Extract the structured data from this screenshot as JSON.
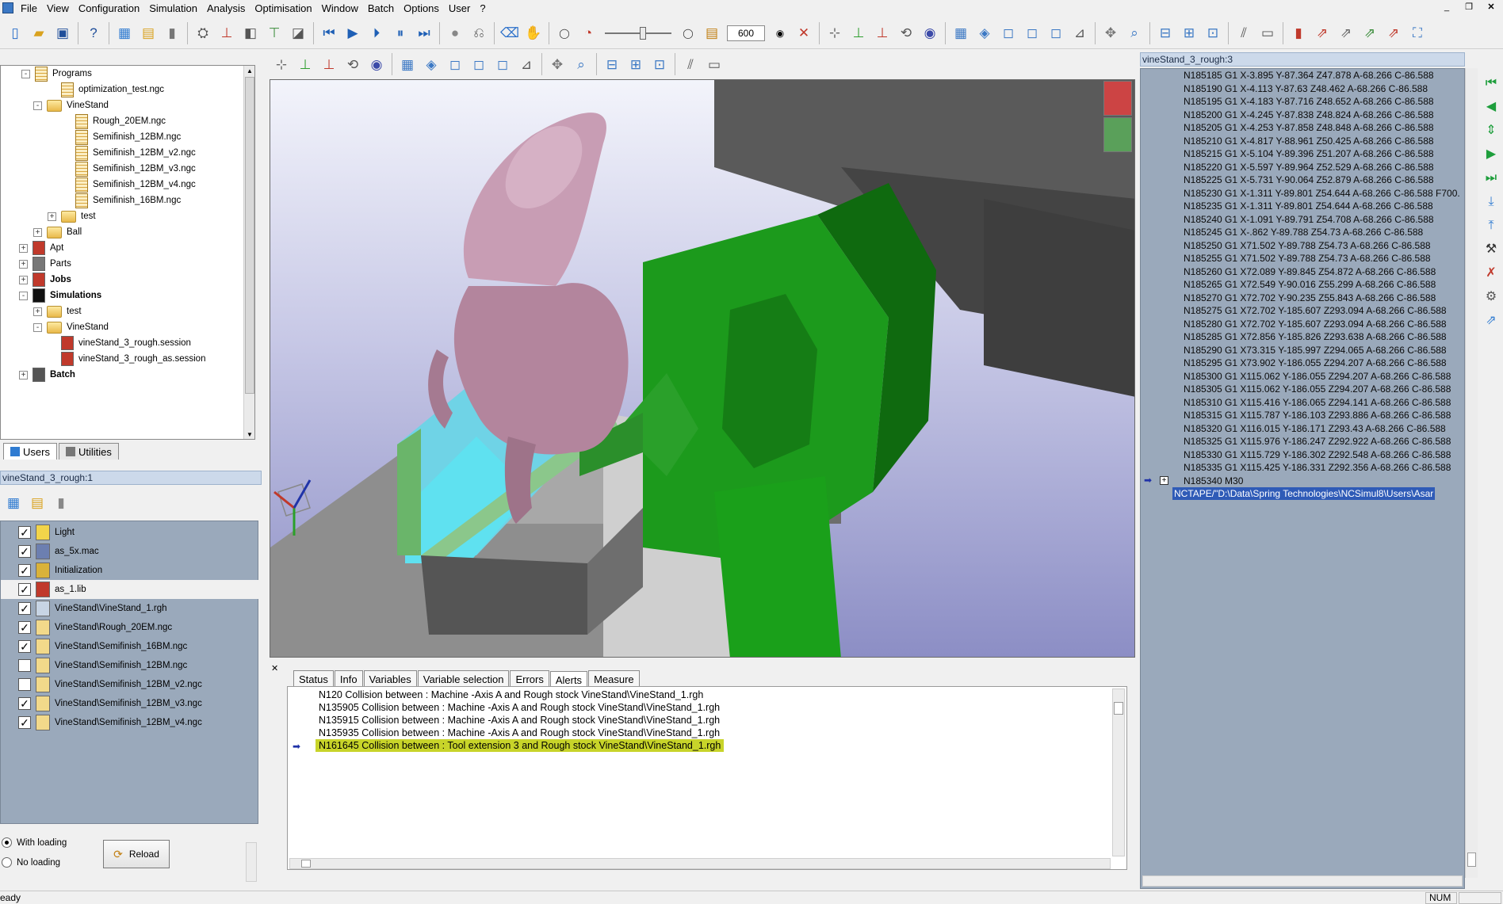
{
  "menu": [
    "File",
    "View",
    "Configuration",
    "Simulation",
    "Analysis",
    "Optimisation",
    "Window",
    "Batch",
    "Options",
    "User",
    "?"
  ],
  "toolbar": {
    "speed_value": "600"
  },
  "tree": {
    "programs_label": "Programs",
    "items": [
      {
        "label": "optimization_test.ngc",
        "indent": 3,
        "kind": "file"
      },
      {
        "label": "VineStand",
        "indent": 2,
        "kind": "folder",
        "exp": "-"
      },
      {
        "label": "Rough_20EM.ngc",
        "indent": 4,
        "kind": "file"
      },
      {
        "label": "Semifinish_12BM.ngc",
        "indent": 4,
        "kind": "file"
      },
      {
        "label": "Semifinish_12BM_v2.ngc",
        "indent": 4,
        "kind": "file"
      },
      {
        "label": "Semifinish_12BM_v3.ngc",
        "indent": 4,
        "kind": "file"
      },
      {
        "label": "Semifinish_12BM_v4.ngc",
        "indent": 4,
        "kind": "file"
      },
      {
        "label": "Semifinish_16BM.ngc",
        "indent": 4,
        "kind": "file"
      },
      {
        "label": "test",
        "indent": 3,
        "kind": "folder",
        "exp": "+"
      },
      {
        "label": "Ball",
        "indent": 2,
        "kind": "folder",
        "exp": "+"
      },
      {
        "label": "Apt",
        "indent": 1,
        "kind": "apt",
        "exp": "+"
      },
      {
        "label": "Parts",
        "indent": 1,
        "kind": "parts",
        "exp": "+"
      },
      {
        "label": "Jobs",
        "indent": 1,
        "kind": "jobs",
        "exp": "+",
        "bold": true
      },
      {
        "label": "Simulations",
        "indent": 1,
        "kind": "sim",
        "exp": "-",
        "bold": true
      },
      {
        "label": "test",
        "indent": 2,
        "kind": "folder",
        "exp": "+"
      },
      {
        "label": "VineStand",
        "indent": 2,
        "kind": "folder",
        "exp": "-"
      },
      {
        "label": "vineStand_3_rough.session",
        "indent": 3,
        "kind": "session"
      },
      {
        "label": "vineStand_3_rough_as.session",
        "indent": 3,
        "kind": "session"
      },
      {
        "label": "Batch",
        "indent": 1,
        "kind": "batch",
        "exp": "+",
        "bold": true
      }
    ]
  },
  "tabs_bottom": [
    {
      "label": "Users",
      "active": true
    },
    {
      "label": "Utilities",
      "active": false
    }
  ],
  "session": {
    "title": "vineStand_3_rough:1",
    "items": [
      {
        "label": "Light",
        "checked": true,
        "icon": "#f2d44a"
      },
      {
        "label": "as_5x.mac",
        "checked": true,
        "icon": "#6c7fb0"
      },
      {
        "label": "Initialization",
        "checked": true,
        "icon": "#d9b23a"
      },
      {
        "label": "as_1.lib",
        "checked": true,
        "icon": "#c0392b",
        "selected": true
      },
      {
        "label": "VineStand\\VineStand_1.rgh",
        "checked": true,
        "icon": "#c7d4e4"
      },
      {
        "label": "VineStand\\Rough_20EM.ngc",
        "checked": true,
        "icon": "#f2d98a"
      },
      {
        "label": "VineStand\\Semifinish_16BM.ngc",
        "checked": true,
        "icon": "#f2d98a"
      },
      {
        "label": "VineStand\\Semifinish_12BM.ngc",
        "checked": false,
        "icon": "#f2d98a"
      },
      {
        "label": "VineStand\\Semifinish_12BM_v2.ngc",
        "checked": false,
        "icon": "#f2d98a"
      },
      {
        "label": "VineStand\\Semifinish_12BM_v3.ngc",
        "checked": true,
        "icon": "#f2d98a"
      },
      {
        "label": "VineStand\\Semifinish_12BM_v4.ngc",
        "checked": true,
        "icon": "#f2d98a"
      }
    ],
    "with_loading": "With loading",
    "no_loading": "No loading",
    "reload": "Reload"
  },
  "alerts": {
    "tabs": [
      "Status",
      "Info",
      "Variables",
      "Variable selection",
      "Errors",
      "Alerts",
      "Measure"
    ],
    "active_tab": "Alerts",
    "rows": [
      {
        "text": "N120  Collision between : Machine -Axis A and Rough stock VineStand\\VineStand_1.rgh",
        "hl": false
      },
      {
        "text": "N135905  Collision between : Machine -Axis A and Rough stock VineStand\\VineStand_1.rgh",
        "hl": false
      },
      {
        "text": "N135915  Collision between : Machine -Axis A and Rough stock VineStand\\VineStand_1.rgh",
        "hl": false
      },
      {
        "text": "N135935  Collision between : Machine -Axis A and Rough stock VineStand\\VineStand_1.rgh",
        "hl": false
      },
      {
        "text": "N161645  Collision between : Tool extension 3 and Rough stock VineStand\\VineStand_1.rgh",
        "hl": true
      }
    ]
  },
  "nc": {
    "title": "vineStand_3_rough:3",
    "lines": [
      "N185185 G1 X-3.895 Y-87.364 Z47.878 A-68.266 C-86.588",
      "N185190 G1 X-4.113 Y-87.63 Z48.462 A-68.266 C-86.588",
      "N185195 G1 X-4.183 Y-87.716 Z48.652 A-68.266 C-86.588",
      "N185200 G1 X-4.245 Y-87.838 Z48.824 A-68.266 C-86.588",
      "N185205 G1 X-4.253 Y-87.858 Z48.848 A-68.266 C-86.588",
      "N185210 G1 X-4.817 Y-88.961 Z50.425 A-68.266 C-86.588",
      "N185215 G1 X-5.104 Y-89.396 Z51.207 A-68.266 C-86.588",
      "N185220 G1 X-5.597 Y-89.964 Z52.529 A-68.266 C-86.588",
      "N185225 G1 X-5.731 Y-90.064 Z52.879 A-68.266 C-86.588",
      "N185230 G1 X-1.311 Y-89.801 Z54.644 A-68.266 C-86.588 F700.",
      "N185235 G1 X-1.311 Y-89.801 Z54.644 A-68.266 C-86.588",
      "N185240 G1 X-1.091 Y-89.791 Z54.708 A-68.266 C-86.588",
      "N185245 G1 X-.862 Y-89.788 Z54.73 A-68.266 C-86.588",
      "N185250 G1 X71.502 Y-89.788 Z54.73 A-68.266 C-86.588",
      "N185255 G1 X71.502 Y-89.788 Z54.73 A-68.266 C-86.588",
      "N185260 G1 X72.089 Y-89.845 Z54.872 A-68.266 C-86.588",
      "N185265 G1 X72.549 Y-90.016 Z55.299 A-68.266 C-86.588",
      "N185270 G1 X72.702 Y-90.235 Z55.843 A-68.266 C-86.588",
      "N185275 G1 X72.702 Y-185.607 Z293.094 A-68.266 C-86.588",
      "N185280 G1 X72.702 Y-185.607 Z293.094 A-68.266 C-86.588",
      "N185285 G1 X72.856 Y-185.826 Z293.638 A-68.266 C-86.588",
      "N185290 G1 X73.315 Y-185.997 Z294.065 A-68.266 C-86.588",
      "N185295 G1 X73.902 Y-186.055 Z294.207 A-68.266 C-86.588",
      "N185300 G1 X115.062 Y-186.055 Z294.207 A-68.266 C-86.588",
      "N185305 G1 X115.062 Y-186.055 Z294.207 A-68.266 C-86.588",
      "N185310 G1 X115.416 Y-186.065 Z294.141 A-68.266 C-86.588",
      "N185315 G1 X115.787 Y-186.103 Z293.886 A-68.266 C-86.588",
      "N185320 G1 X116.015 Y-186.171 Z293.43 A-68.266 C-86.588",
      "N185325 G1 X115.976 Y-186.247 Z292.922 A-68.266 C-86.588",
      "N185330 G1 X115.729 Y-186.302 Z292.548 A-68.266 C-86.588",
      "N185335 G1 X115.425 Y-186.331 Z292.356 A-68.266 C-86.588",
      "N185340 M30"
    ],
    "current": "NCTAPE/\"D:\\Data\\Spring Technologies\\NCSimul8\\Users\\Asar"
  },
  "status": {
    "left": "eady",
    "num": "NUM"
  }
}
